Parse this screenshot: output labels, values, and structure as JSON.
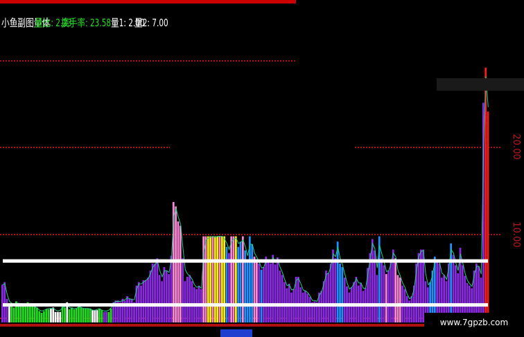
{
  "header": {
    "indicator_name": "小鱼副图量体",
    "labels": [
      {
        "text": "量比: 2.23",
        "color": "#22dd22"
      },
      {
        "text": "换手率: 23.58",
        "color": "#22dd22"
      },
      {
        "text": "量1: 2.00",
        "color": "#ffffff"
      },
      {
        "text": "量2: 7.00",
        "color": "#ffffff"
      }
    ]
  },
  "watermark": "www.7gpzb.com",
  "colors": {
    "background": "#000000",
    "grid": "#b01010",
    "axis_label": "#c01818",
    "green": "#22dd22",
    "white": "#ffffff",
    "purple": "#8a2be2",
    "pink": "#ff88d8",
    "blue": "#1e90ff",
    "yellow": "#ffee00",
    "red": "#ff1a1a",
    "line": "#22cc88"
  },
  "chart_data": {
    "type": "bar",
    "ytick_labels": [
      "20.00",
      "10.00"
    ],
    "ytick_values": [
      20,
      10
    ],
    "ylim": [
      0,
      35
    ],
    "threshold_lines": [
      {
        "value": 7.0,
        "color": "#ffffff"
      },
      {
        "value": 2.0,
        "color": "#ffffff"
      }
    ],
    "series": [
      {
        "values": [
          4.3,
          4.6,
          2.7,
          1.8,
          2.2,
          1.7,
          2.4,
          2.2,
          2.2,
          2.0,
          1.8,
          2.3,
          2.0,
          1.9,
          1.8,
          1.7,
          1.3,
          1.1,
          1.3,
          1.5,
          1.5,
          1.6,
          1.7,
          1.2,
          1.2,
          1.2,
          1.8,
          1.7,
          2.3,
          1.5,
          1.7,
          1.5,
          1.6,
          2.0,
          1.7,
          1.6,
          1.6,
          1.6,
          1.6,
          1.4,
          1.4,
          1.4,
          1.6,
          1.4,
          1.2,
          1.2,
          1.2,
          1.6,
          2.3,
          2.5,
          2.5,
          2.3,
          2.7,
          2.5,
          3.0,
          2.7,
          2.7,
          2.3,
          4.2,
          4.6,
          4.2,
          4.8,
          4.8,
          5.1,
          5.9,
          6.7,
          6.7,
          7.3,
          5.4,
          4.7,
          6.3,
          5.9,
          5.5,
          7.6,
          13.7,
          13.2,
          11.5,
          11.0,
          7.3,
          4.7,
          5.2,
          5.4,
          4.7,
          4.0,
          3.8,
          4.2,
          3.8,
          9.8,
          9.8,
          9.8,
          9.8,
          9.8,
          9.8,
          9.8,
          9.8,
          9.8,
          9.8,
          8.6,
          7.9,
          9.8,
          9.8,
          9.8,
          8.6,
          9.2,
          9.8,
          8.2,
          7.1,
          9.8,
          8.9,
          7.5,
          7.2,
          6.7,
          6.0,
          6.3,
          7.5,
          6.9,
          6.7,
          7.7,
          6.6,
          7.4,
          5.9,
          5.4,
          4.6,
          3.9,
          4.4,
          3.4,
          3.8,
          5.2,
          5.2,
          4.0,
          3.4,
          3.6,
          3.3,
          2.9,
          2.3,
          2.4,
          2.3,
          3.4,
          3.6,
          4.7,
          5.9,
          5.6,
          6.7,
          8.3,
          7.3,
          9.2,
          6.7,
          6.3,
          5.1,
          4.1,
          3.4,
          4.0,
          4.6,
          5.2,
          4.2,
          4.5,
          3.6,
          3.9,
          6.2,
          7.9,
          9.5,
          8.2,
          5.4,
          9.8,
          7.3,
          6.5,
          5.5,
          5.9,
          7.0,
          8.3,
          7.3,
          5.4,
          5.1,
          4.2,
          3.8,
          3.0,
          2.5,
          3.0,
          4.2,
          6.7,
          7.9,
          8.3,
          8.3,
          4.7,
          4.0,
          4.6,
          5.9,
          7.5,
          7.0,
          6.7,
          5.1,
          5.4,
          4.7,
          6.7,
          9.0,
          7.7,
          6.5,
          5.6,
          8.5,
          6.5,
          5.3,
          4.5,
          4.2,
          3.9,
          5.9,
          6.7,
          6.4,
          5.1,
          25.0,
          29.0,
          24.0
        ],
        "colors": [
          "p",
          "p",
          "p",
          "w",
          "g",
          "g",
          "g",
          "g",
          "g",
          "g",
          "g",
          "g",
          "g",
          "g",
          "g",
          "g",
          "g",
          "g",
          "g",
          "g",
          "g",
          "w",
          "w",
          "w",
          "w",
          "w",
          "g",
          "g",
          "w",
          "g",
          "g",
          "g",
          "g",
          "g",
          "g",
          "g",
          "g",
          "g",
          "g",
          "w",
          "w",
          "w",
          "g",
          "g",
          "p",
          "p",
          "g",
          "g",
          "p",
          "p",
          "p",
          "p",
          "p",
          "p",
          "p",
          "p",
          "p",
          "p",
          "p",
          "p",
          "p",
          "p",
          "p",
          "p",
          "p",
          "p",
          "p",
          "p",
          "p",
          "p",
          "p",
          "p",
          "p",
          "p",
          "k",
          "k",
          "k",
          "k",
          "p",
          "p",
          "p",
          "p",
          "p",
          "p",
          "p",
          "p",
          "p",
          "k",
          "k",
          "y",
          "y",
          "k",
          "y",
          "y",
          "k",
          "y",
          "y",
          "b",
          "p",
          "k",
          "k",
          "y",
          "b",
          "b",
          "k",
          "b",
          "b",
          "b",
          "b",
          "k",
          "k",
          "p",
          "b",
          "p",
          "p",
          "p",
          "p",
          "p",
          "p",
          "p",
          "p",
          "p",
          "p",
          "p",
          "p",
          "p",
          "p",
          "p",
          "p",
          "p",
          "p",
          "p",
          "p",
          "p",
          "p",
          "p",
          "p",
          "p",
          "p",
          "p",
          "p",
          "p",
          "p",
          "p",
          "p",
          "b",
          "b",
          "b",
          "p",
          "p",
          "p",
          "p",
          "p",
          "p",
          "p",
          "p",
          "p",
          "p",
          "p",
          "p",
          "p",
          "p",
          "p",
          "b",
          "p",
          "p",
          "k",
          "p",
          "p",
          "p",
          "k",
          "k",
          "k",
          "p",
          "p",
          "p",
          "p",
          "p",
          "p",
          "p",
          "p",
          "p",
          "p",
          "p",
          "p",
          "b",
          "b",
          "b",
          "p",
          "p",
          "p",
          "p",
          "p",
          "p",
          "b",
          "p",
          "p",
          "p",
          "p",
          "p",
          "p",
          "p",
          "p",
          "p",
          "p",
          "p",
          "p",
          "p",
          "p",
          "r",
          "r",
          "r"
        ]
      }
    ],
    "volume_line": [
      4.3,
      4.4,
      3.2,
      2.4,
      2.2,
      2.0,
      2.2,
      2.2,
      2.1,
      2.0,
      2.0,
      2.1,
      2.0,
      1.9,
      1.8,
      1.6,
      1.4,
      1.3,
      1.4,
      1.5,
      1.6,
      1.6,
      1.6,
      1.4,
      1.3,
      1.4,
      1.7,
      1.8,
      2.0,
      1.7,
      1.6,
      1.6,
      1.6,
      1.8,
      1.7,
      1.6,
      1.6,
      1.6,
      1.5,
      1.4,
      1.4,
      1.5,
      1.5,
      1.4,
      1.3,
      1.3,
      1.4,
      1.7,
      2.2,
      2.4,
      2.4,
      2.4,
      2.5,
      2.6,
      2.8,
      2.7,
      2.6,
      2.6,
      3.8,
      4.4,
      4.4,
      4.6,
      4.8,
      5.0,
      5.6,
      6.3,
      6.6,
      7.0,
      5.9,
      5.2,
      5.9,
      5.9,
      5.7,
      7.0,
      12.0,
      13.0,
      12.0,
      11.2,
      8.5,
      6.0,
      5.5,
      5.3,
      4.9,
      4.3,
      4.0,
      4.1,
      3.9,
      8.0,
      9.4,
      9.6,
      9.7,
      9.8,
      9.7,
      9.8,
      9.8,
      9.8,
      9.5,
      9.0,
      8.3,
      9.2,
      9.5,
      9.6,
      9.0,
      9.1,
      9.4,
      8.6,
      7.6,
      8.9,
      8.9,
      7.9,
      7.4,
      6.9,
      6.2,
      6.3,
      7.1,
      7.0,
      6.8,
      7.4,
      6.8,
      7.2,
      6.3,
      5.7,
      4.9,
      4.2,
      4.3,
      3.7,
      3.8,
      4.8,
      5.0,
      4.4,
      3.7,
      3.6,
      3.4,
      3.0,
      2.5,
      2.5,
      2.4,
      3.1,
      3.5,
      4.4,
      5.5,
      5.6,
      6.4,
      7.8,
      7.5,
      8.6,
      7.3,
      6.6,
      5.5,
      4.5,
      3.8,
      4.0,
      4.4,
      5.0,
      4.5,
      4.5,
      3.9,
      3.9,
      5.5,
      7.3,
      9.0,
      8.4,
      6.2,
      8.8,
      7.8,
      6.9,
      5.8,
      5.9,
      6.7,
      7.9,
      7.5,
      5.9,
      5.3,
      4.5,
      4.0,
      3.2,
      2.7,
      2.9,
      3.8,
      6.0,
      7.5,
      8.1,
      8.2,
      5.5,
      4.3,
      4.5,
      5.5,
      7.0,
      7.0,
      6.8,
      5.6,
      5.4,
      4.9,
      6.2,
      8.3,
      7.9,
      6.8,
      5.9,
      7.8,
      6.8,
      5.6,
      4.8,
      4.4,
      4.1,
      5.4,
      6.4,
      6.4,
      5.5,
      20.0,
      28.0,
      24.5
    ]
  }
}
